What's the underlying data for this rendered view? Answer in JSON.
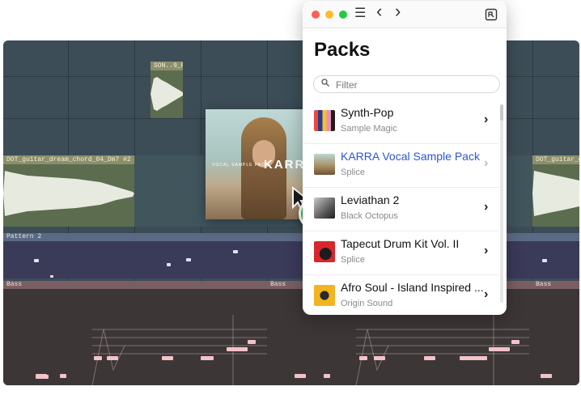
{
  "daw": {
    "audio_clips": [
      {
        "label": "SON..9_F"
      },
      {
        "label": "DOT_guitar_dream_chord_04_Dm7 #2"
      },
      {
        "label": "DOT_guitar_dream"
      }
    ],
    "pattern_label": "Pattern 2",
    "bass_labels": [
      "Bass",
      "Bass",
      "Bass"
    ]
  },
  "drag_card": {
    "title": "KARRA",
    "subtitle": "VOCAL SAMPLE PACK"
  },
  "add_button": {
    "symbol": "+"
  },
  "packs_window": {
    "title": "Packs",
    "filter": {
      "placeholder": "Filter"
    },
    "nav": {
      "menu": "☰",
      "back": "‹",
      "forward": "›"
    },
    "items": [
      {
        "name": "Synth-Pop",
        "creator": "Sample Magic",
        "chevron": "›"
      },
      {
        "name": "KARRA Vocal Sample Pack",
        "creator": "Splice",
        "chevron": "›"
      },
      {
        "name": "Leviathan 2",
        "creator": "Black Octopus",
        "chevron": "›"
      },
      {
        "name": "Tapecut Drum Kit Vol. II",
        "creator": "Splice",
        "chevron": "›"
      },
      {
        "name": "Afro Soul - Island Inspired ...",
        "creator": "Origin Sound",
        "chevron": "›"
      }
    ]
  },
  "colors": {
    "accent_blue": "#2d55d6",
    "add_green": "#2fb55e",
    "close": "#fc5f57",
    "minimize": "#fdbc2e",
    "zoom": "#28c840"
  }
}
